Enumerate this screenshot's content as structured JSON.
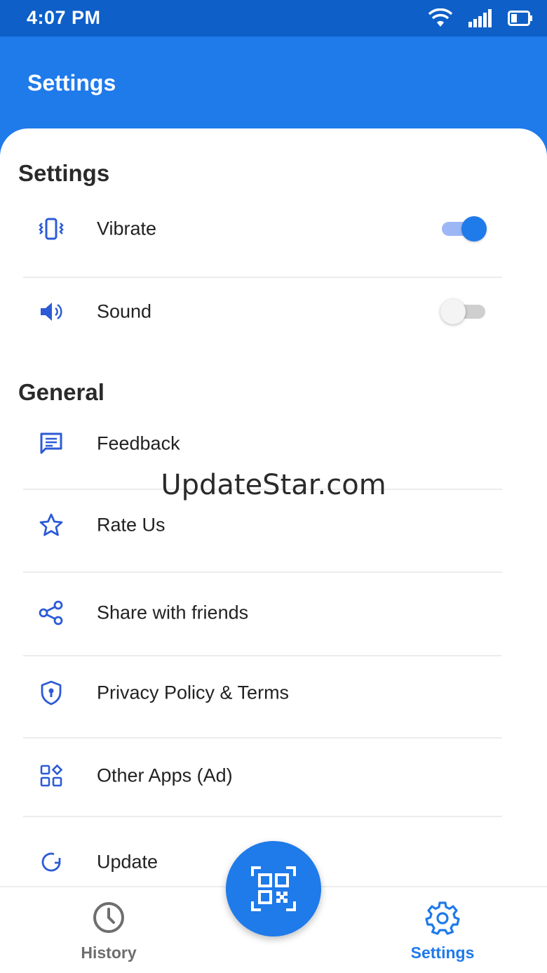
{
  "status_bar": {
    "time": "4:07 PM"
  },
  "app_bar": {
    "title": "Settings"
  },
  "sections": {
    "settings_heading": "Settings",
    "general_heading": "General"
  },
  "settings_items": [
    {
      "label": "Vibrate",
      "icon": "vibrate-icon",
      "enabled": true
    },
    {
      "label": "Sound",
      "icon": "volume-icon",
      "enabled": false
    }
  ],
  "general_items": [
    {
      "label": "Feedback",
      "icon": "feedback-icon"
    },
    {
      "label": "Rate Us",
      "icon": "star-icon"
    },
    {
      "label": "Share with friends",
      "icon": "share-icon"
    },
    {
      "label": "Privacy Policy & Terms",
      "icon": "shield-icon"
    },
    {
      "label": "Other Apps (Ad)",
      "icon": "apps-icon"
    },
    {
      "label": "Update",
      "icon": "refresh-icon"
    }
  ],
  "watermark": "UpdateStar.com",
  "bottom_nav": {
    "history_label": "History",
    "settings_label": "Settings",
    "active": "Settings"
  },
  "colors": {
    "primary": "#1f7aea",
    "status_bar": "#0e5fc7",
    "icon_blue": "#2d5bd6",
    "inactive_gray": "#6e6e6e"
  }
}
